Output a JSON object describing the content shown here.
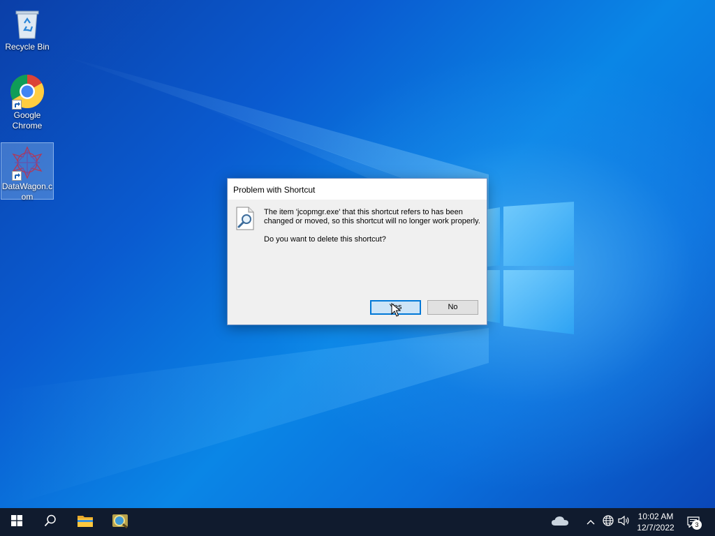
{
  "desktop": {
    "icons": [
      {
        "label": "Recycle Bin",
        "icon": "recycle-bin-icon"
      },
      {
        "label": "Google\nChrome",
        "icon": "chrome-icon"
      },
      {
        "label": "DataWagon.com",
        "icon": "datawagon-icon",
        "selected": true
      }
    ]
  },
  "dialog": {
    "title": "Problem with Shortcut",
    "icon": "missing-file-search-icon",
    "message": "The item 'jcopmgr.exe' that this shortcut refers to has been changed or moved, so this shortcut will no longer work properly.",
    "question": "Do you want to delete this shortcut?",
    "yes_label": "Yes",
    "no_label": "No",
    "default_button": "Yes"
  },
  "taskbar": {
    "buttons": [
      {
        "name": "start",
        "icon": "windows-start-icon"
      },
      {
        "name": "search",
        "icon": "search-icon"
      },
      {
        "name": "file-explorer",
        "icon": "folder-icon"
      },
      {
        "name": "app",
        "icon": "magnifier-app-icon"
      }
    ],
    "tray": {
      "icons": [
        "onedrive-cloud-icon",
        "chevron-up-icon",
        "network-globe-icon",
        "speaker-icon"
      ],
      "time": "10:02 AM",
      "date": "12/7/2022",
      "notification_count": "3"
    }
  },
  "colors": {
    "accent": "#0078d7",
    "taskbar": "#101b2e",
    "dialog_bg": "#f0f0f0"
  }
}
